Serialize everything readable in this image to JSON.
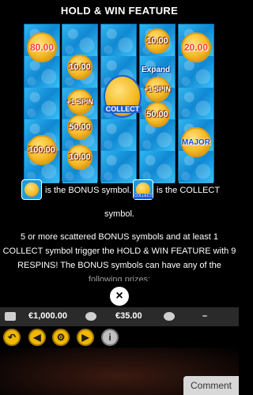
{
  "title": "HOLD & WIN FEATURE",
  "reels": {
    "coins": {
      "c1": "80.00",
      "c2": "10.00",
      "c3": "10.00",
      "c4": "20.00",
      "c5": "50.00",
      "c6": "50.00",
      "c7": "100.00",
      "c8": "10.00",
      "c9": "+1 SPIN",
      "c10": "+1 SPIN",
      "major": "MAJOR"
    },
    "expand": "Expand",
    "collect": "COLLECT",
    "collect_small": "COLLECT"
  },
  "description": {
    "bonus_text": "is the BONUS symbol.",
    "collect_text": "is the COLLECT",
    "symbol_word": "symbol.",
    "line1": "5 or more scattered BONUS symbols and at least 1",
    "line2": "COLLECT symbol trigger the HOLD & WIN FEATURE with 9",
    "line3": "RESPINS! The BONUS symbols can have any of the",
    "line4": "following prizes:"
  },
  "status_bar": {
    "balance": "€1,000.00",
    "bet": "€35.00",
    "win": "–"
  },
  "close_symbol": "×",
  "controls": {
    "back": "↶",
    "prev": "◀",
    "settings": "⚙",
    "next": "▶",
    "info": "i"
  },
  "comment_button": "Comment",
  "colors": {
    "reel_blue": "#1b9be0",
    "coin_gold": "#f4b824",
    "button_gold": "#f0b800",
    "collect_blue": "#1a5fc9"
  }
}
